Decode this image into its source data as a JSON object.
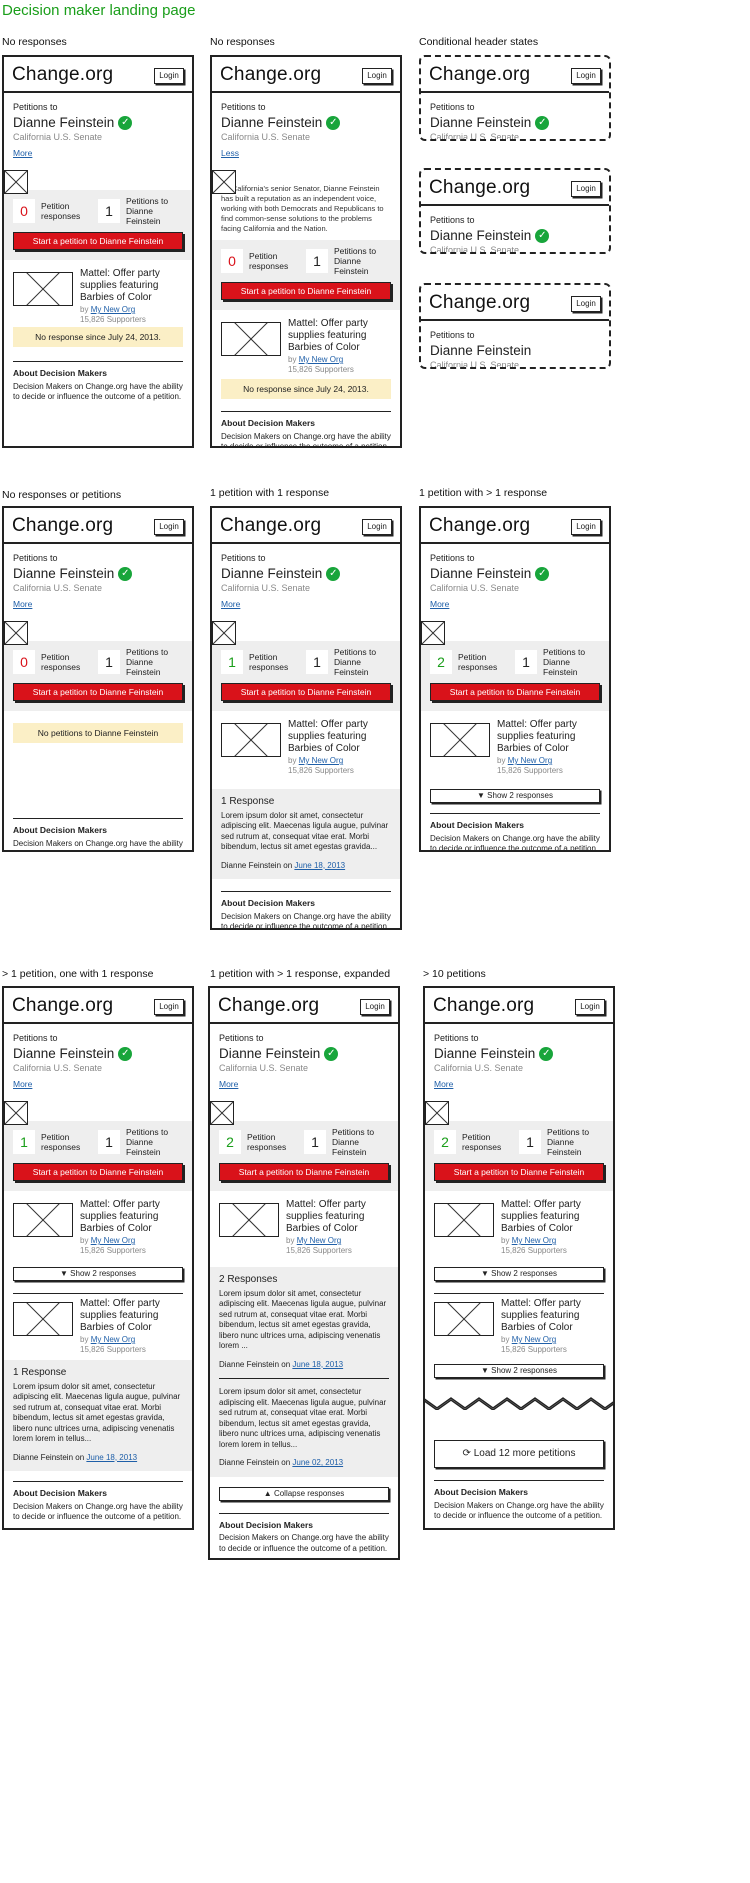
{
  "title": "Decision maker landing page",
  "labels": {
    "s1": "No responses",
    "s2": "No responses",
    "s3": "Conditional header states",
    "s4": "No responses or petitions",
    "s5": "1 petition with 1 response",
    "s6": "1 petition with > 1 response",
    "s7": "> 1 petition, one with 1 response",
    "s8": "1 petition with > 1 response, expanded",
    "s9": "> 10 petitions"
  },
  "common": {
    "logo": "Change.org",
    "login": "Login",
    "petitions_to": "Petitions to",
    "dm_name": "Dianne Feinstein",
    "dm_title": "California  U.S. Senate",
    "more": "More",
    "less": "Less",
    "bio": "As California's senior Senator, Dianne Feinstein has built a reputation as an independent voice, working with both Democrats and Republicans to find common-sense solutions to the problems facing California and the Nation.",
    "stat_responses": "Petition responses",
    "stat_petitions": "Petitions to Dianne Feinstein",
    "start_button": "Start a petition to Dianne Feinstein",
    "petition_title": "Mattel: Offer party supplies featuring Barbies of Color",
    "by": "by",
    "org": "My New Org",
    "supporters": "15,826 Supporters",
    "no_response": "No response since July 24, 2013.",
    "no_petitions": "No petitions to Dianne Feinstein",
    "about_title": "About Decision Makers",
    "about_text": "Decision Makers on Change.org have the ability to decide or influence the outcome of a petition.",
    "show_responses": "▼ Show 2 responses",
    "collapse": "▲ Collapse responses",
    "one_response": "1 Response",
    "two_responses": "2 Responses",
    "lorem_short": "Lorem ipsum dolor sit amet, consectetur adipiscing elit. Maecenas ligula augue, pulvinar sed rutrum at, consequat vitae erat. Morbi bibendum, lectus sit amet egestas gravida...",
    "lorem_long": "Lorem ipsum dolor sit amet, consectetur adipiscing elit. Maecenas ligula augue, pulvinar sed rutrum at, consequat vitae erat. Morbi bibendum, lectus sit amet egestas gravida, libero nunc ultrices urna, adipiscing venenatis lorem lorem in tellus...",
    "lorem_mid": "Lorem ipsum dolor sit amet, consectetur adipiscing elit. Maecenas ligula augue, pulvinar sed rutrum at, consequat vitae erat. Morbi bibendum, lectus sit amet egestas gravida, libero nunc ultrices urna, adipiscing venenatis lorem ...",
    "resp_by": "Dianne Feinstein on",
    "date1": "June 18, 2013",
    "date2": "June 02, 2013",
    "load_more": "Load 12 more petitions"
  },
  "stats": {
    "zero": "0",
    "one": "1",
    "two": "2"
  }
}
